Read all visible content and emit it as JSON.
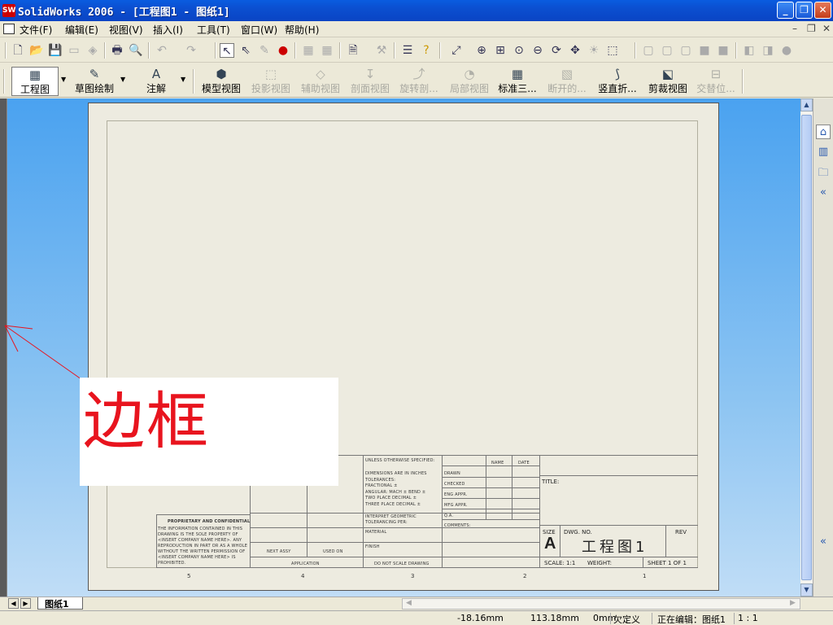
{
  "window": {
    "title": "SolidWorks 2006 - [工程图1 - 图纸1]",
    "app_icon_text": "SW"
  },
  "menu": [
    "文件(F)",
    "编辑(E)",
    "视图(V)",
    "插入(I)",
    "工具(T)",
    "窗口(W)",
    "帮助(H)"
  ],
  "drawing_toolbar": {
    "items": [
      {
        "label": "工程图",
        "state": "pressed"
      },
      {
        "label": "草图绘制",
        "state": "enabled"
      },
      {
        "label": "注解",
        "state": "enabled"
      },
      {
        "label": "模型视图",
        "state": "enabled"
      },
      {
        "label": "投影视图",
        "state": "disabled"
      },
      {
        "label": "辅助视图",
        "state": "disabled"
      },
      {
        "label": "剖面视图",
        "state": "disabled"
      },
      {
        "label": "旋转剖...",
        "state": "disabled"
      },
      {
        "label": "局部视图",
        "state": "disabled"
      },
      {
        "label": "标准三...",
        "state": "enabled"
      },
      {
        "label": "断开的...",
        "state": "disabled"
      },
      {
        "label": "竖直折...",
        "state": "enabled"
      },
      {
        "label": "剪裁视图",
        "state": "enabled"
      },
      {
        "label": "交替位...",
        "state": "disabled"
      }
    ]
  },
  "annotation": {
    "text": "边框",
    "color": "#e8141e"
  },
  "title_block": {
    "unless_specified": "UNLESS OTHERWISE SPECIFIED:",
    "dimensions": "DIMENSIONS ARE IN INCHES",
    "tolerances": "TOLERANCES:",
    "fractional": "FRACTIONAL ±",
    "angular": "ANGULAR: MACH ±   BEND ±",
    "two_place": "TWO PLACE DECIMAL   ±",
    "three_place": "THREE PLACE DECIMAL  ±",
    "interpret": "INTERPRET GEOMETRIC",
    "tol_per": "TOLERANCING PER:",
    "material": "MATERIAL",
    "finish": "FINISH",
    "do_not_scale": "DO NOT SCALE DRAWING",
    "application": "APPLICATION",
    "next_assy": "NEXT ASSY",
    "used_on": "USED ON",
    "name_hdr": "NAME",
    "date_hdr": "DATE",
    "drawn": "DRAWN",
    "checked": "CHECKED",
    "eng_appr": "ENG APPR.",
    "mfg_appr": "MFG APPR.",
    "qa": "Q.A.",
    "comments": "COMMENTS:",
    "title": "TITLE:",
    "size_label": "SIZE",
    "size_value": "A",
    "dwg_no_label": "DWG. NO.",
    "dwg_no_value": "工程图1",
    "rev": "REV",
    "scale": "SCALE: 1:1",
    "weight": "WEIGHT:",
    "sheet": "SHEET 1 OF 1",
    "proprietary": "PROPRIETARY AND CONFIDENTIAL",
    "prop_body_1": "THE INFORMATION CONTAINED IN THIS",
    "prop_body_2": "DRAWING IS THE SOLE PROPERTY OF",
    "prop_body_3": "<INSERT COMPANY NAME HERE>. ANY",
    "prop_body_4": "REPRODUCTION IN PART OR AS A WHOLE",
    "prop_body_5": "WITHOUT THE WRITTEN PERMISSION OF",
    "prop_body_6": "<INSERT COMPANY NAME HERE> IS",
    "prop_body_7": "PROHIBITED.",
    "zones": [
      "5",
      "4",
      "3",
      "2",
      "1"
    ]
  },
  "sheet_tabs": [
    "图纸1"
  ],
  "status": {
    "x": "-18.16mm",
    "y": "113.18mm",
    "z": "0mm",
    "state": "欠定义",
    "editing": "正在编辑：图纸1",
    "scale": "1 : 1"
  }
}
